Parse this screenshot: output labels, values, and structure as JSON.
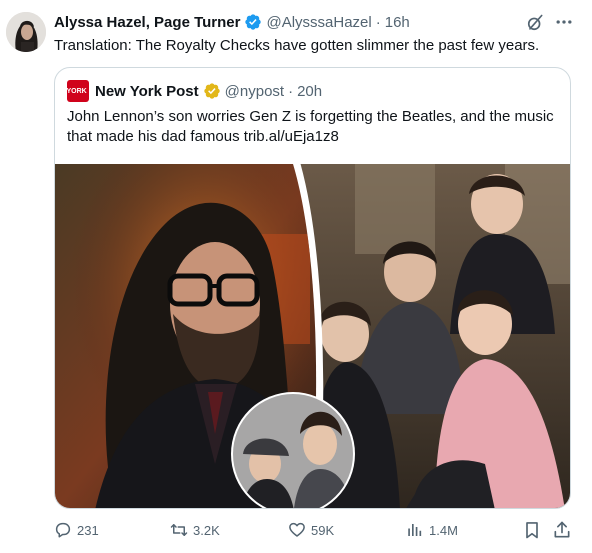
{
  "tweet": {
    "author_name": "Alyssa Hazel, Page Turner",
    "handle": "@AlysssaHazel",
    "separator": "·",
    "time": "16h",
    "text": "Translation: The Royalty Checks have gotten slimmer the past few years."
  },
  "quoted": {
    "logo_text": "NEW YORK POST",
    "author_name": "New York Post",
    "handle": "@nypost",
    "separator": "·",
    "time": "20h",
    "text": "John Lennon’s son worries Gen Z is forgetting the Beatles, and the music that made his dad famous trib.al/uEja1z8"
  },
  "actions": {
    "replies": "231",
    "reposts": "3.2K",
    "likes": "59K",
    "views": "1.4M"
  },
  "icons": {
    "verified": "verified-badge-blue",
    "gold_check": "verified-badge-gold",
    "grok": "grok-icon",
    "more": "more-icon",
    "reply": "reply-icon",
    "repost": "repost-icon",
    "like": "heart-icon",
    "views": "views-icon",
    "bookmark": "bookmark-icon",
    "share": "share-icon"
  },
  "colors": {
    "text": "#0f1419",
    "secondary": "#536471",
    "border": "#cfd9de",
    "verified_blue": "#1d9bf0",
    "verified_gold": "#e2b719",
    "nypost_red": "#d0021b"
  }
}
